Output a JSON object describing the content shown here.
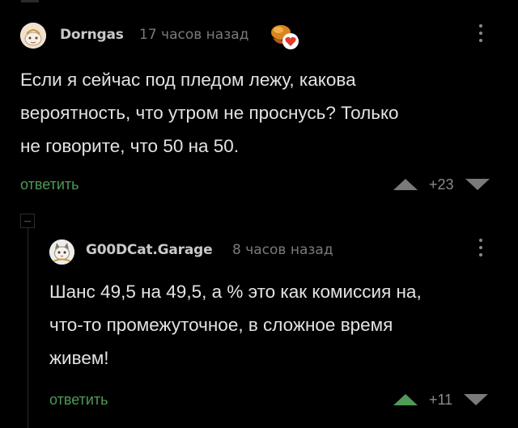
{
  "comments": [
    {
      "author": "Dorngas",
      "time": "17 часов назад",
      "text": "Если я сейчас под пледом лежу,  какова\nвероятность,  что утром не проснусь?  Только\nне говорите,  что 50 на 50.",
      "reply_label": "ответить",
      "score": "+23",
      "avatar_icon": "avatar-sketch-icon",
      "badge_icon": "award-badge-icon"
    },
    {
      "author": "G00DCat.Garage",
      "time": "8 часов назад",
      "text": "Шанс 49,5 на 49,5, а % это как комиссия на,\nчто-то промежуточное, в сложное время\nживем!",
      "reply_label": "ответить",
      "score": "+11",
      "avatar_icon": "avatar-cat-icon"
    }
  ],
  "colors": {
    "background": "#000000",
    "text": "#e3e3e3",
    "reply": "#4f9a55",
    "upvote_active": "#4f9a55",
    "muted": "#7a7a7a"
  }
}
